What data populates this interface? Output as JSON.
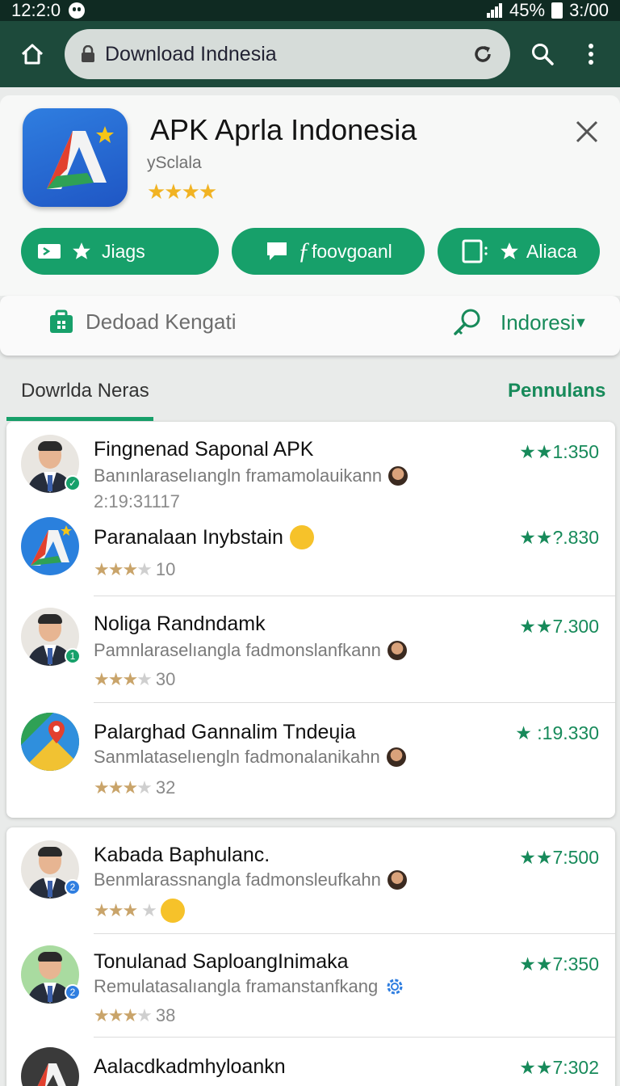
{
  "status_bar": {
    "time": "12:2:0",
    "battery": "45%",
    "clock_right": "3:/00"
  },
  "browser": {
    "url_text": "Download Indnesia"
  },
  "app": {
    "title": "APK Aprla Indonesia",
    "developer": "ySclala",
    "rating_stars": "★★★★",
    "actions": [
      {
        "label": "Jiags",
        "icon": "video-icon"
      },
      {
        "label": "foovgoanl",
        "icon": "chat-icon"
      },
      {
        "label": "Aliaca",
        "icon": "tablet-icon"
      }
    ]
  },
  "filter": {
    "left_label": "Dedoad Kengati",
    "region_label": "Indoresi"
  },
  "tabs": {
    "left": "Dowrlda Neras",
    "right": "Pennulans"
  },
  "list": [
    {
      "title": "Fingnenad Saponal APK",
      "subtitle": "Banınlaraselıangln framamolauikann",
      "meta": "2:19:31117",
      "count": "★★1:350"
    },
    {
      "title": "Paranalaan Inybstain",
      "rating_num": "10",
      "count": "★★?.830"
    },
    {
      "title": "Noliga Randndamk",
      "subtitle": "Pamnlaraselıangla fadmonslanfkann",
      "rating_num": "30",
      "count": "★★7.300"
    },
    {
      "title": "Palarghad Gannalim Tndeųia",
      "subtitle": "Sanmlataselıengln fadmonalanikahn",
      "rating_num": "32",
      "count": "★ :19.330"
    },
    {
      "title": "Kabada Baphulanc.",
      "subtitle": "Benmlarassnangla fadmonsleufkahn",
      "count": "★★7:500"
    },
    {
      "title": "Tonulanad SaploangInimaka",
      "subtitle": "Remulatasalıangla framanstanfkang",
      "rating_num": "38",
      "count": "★★7:350"
    },
    {
      "title": "Aalacdkadmhyloankn",
      "count": "★★7:302"
    }
  ]
}
